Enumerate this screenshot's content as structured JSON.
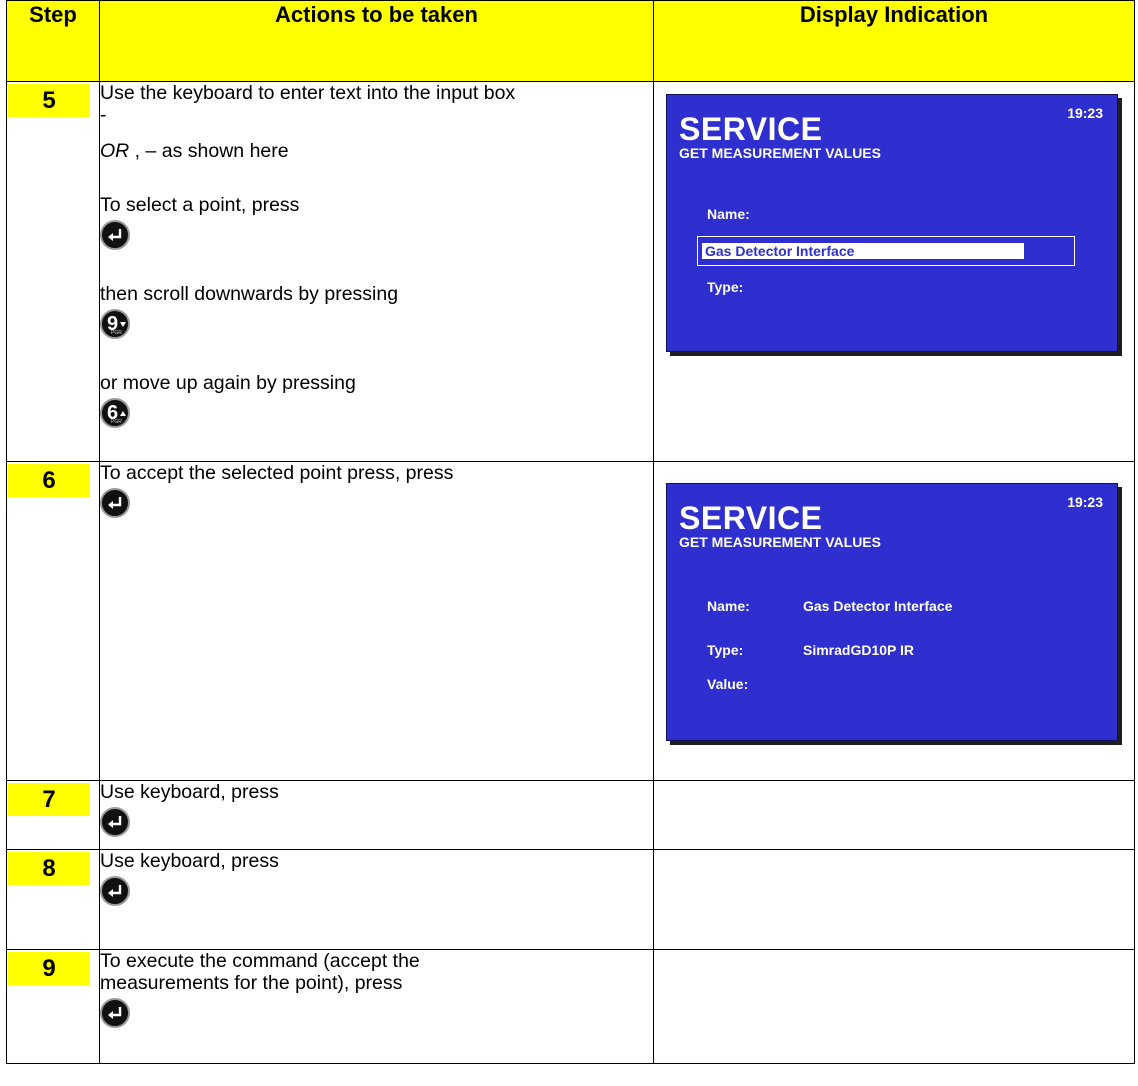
{
  "header": {
    "step": "Step",
    "actions": "Actions to be taken",
    "display": "Display Indication"
  },
  "rows": [
    {
      "step": "5",
      "lines": [
        "Use the keyboard to enter text into the input box",
        "-",
        "OR , – as shown here",
        "To select a point, press",
        "then scroll downwards by pressing",
        "or move up again by pressing"
      ],
      "or_word": "OR",
      "or_rest": " , – as shown here"
    },
    {
      "step": "6",
      "lines": [
        "To accept the selected point press, press"
      ]
    },
    {
      "step": "7",
      "lines": [
        "Use keyboard, press"
      ]
    },
    {
      "step": "8",
      "lines": [
        "Use keyboard, press"
      ]
    },
    {
      "step": "9",
      "lines": [
        "To execute the command (accept the",
        "measurements for the point), press"
      ]
    }
  ],
  "keys": {
    "enter": "enter-key",
    "down_digit": "9",
    "down_sub": "PGR",
    "up_digit": "6",
    "up_sub": "PGR"
  },
  "screen1": {
    "title": "SERVICE",
    "subtitle": "GET MEASUREMENT VALUES",
    "clock": "19:23",
    "name_label": "Name:",
    "input_value": "Gas Detector Interface",
    "type_label": "Type:"
  },
  "screen2": {
    "title": "SERVICE",
    "subtitle": "GET MEASUREMENT VALUES",
    "clock": "19:23",
    "name_label": "Name:",
    "name_value": "Gas Detector Interface",
    "type_label": "Type:",
    "type_value": "SimradGD10P IR",
    "value_label": "Value:"
  },
  "colors": {
    "highlight": "#ffff00",
    "screen_bg": "#2f2fcf",
    "screen_text": "#ffffff"
  }
}
